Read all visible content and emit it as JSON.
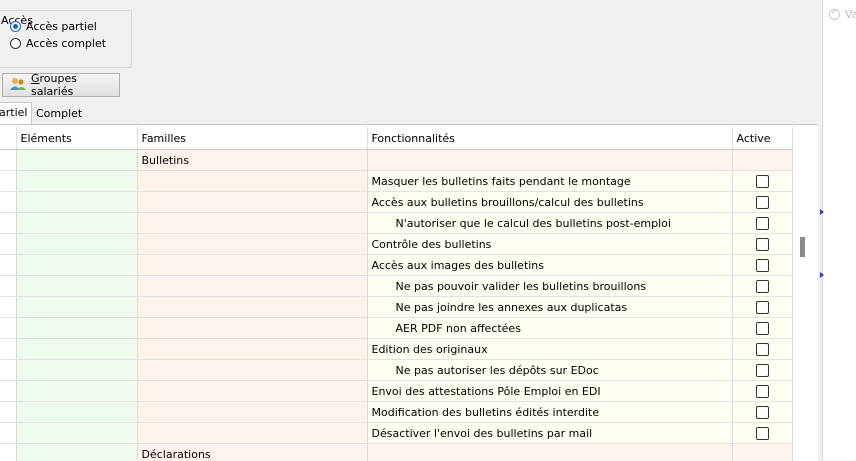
{
  "acces": {
    "legend": "Accès",
    "options": [
      {
        "label": "Accès partiel",
        "selected": true
      },
      {
        "label": "Accès complet",
        "selected": false
      }
    ]
  },
  "groupes_button": {
    "label_underlined": "G",
    "label_rest": "roupes salariés",
    "icon": "group-users-icon"
  },
  "tabs": [
    {
      "label": "artiel",
      "active": true
    },
    {
      "label": "Complet",
      "active": false
    }
  ],
  "grid": {
    "columns": [
      "",
      "Eléments",
      "Familles",
      "Fonctionnalités",
      "Active"
    ],
    "rows": [
      {
        "famille": "Bulletins",
        "fonction": "",
        "indent": false,
        "checkbox": false
      },
      {
        "famille": "",
        "fonction": "Masquer les bulletins faits pendant le montage",
        "indent": false,
        "checkbox": true
      },
      {
        "famille": "",
        "fonction": "Accès aux bulletins brouillons/calcul des bulletins",
        "indent": false,
        "checkbox": true
      },
      {
        "famille": "",
        "fonction": "N'autoriser que le calcul des bulletins post-emploi",
        "indent": true,
        "checkbox": true
      },
      {
        "famille": "",
        "fonction": "Contrôle des bulletins",
        "indent": false,
        "checkbox": true
      },
      {
        "famille": "",
        "fonction": "Accès aux images des bulletins",
        "indent": false,
        "checkbox": true
      },
      {
        "famille": "",
        "fonction": "Ne pas pouvoir valider les bulletins brouillons",
        "indent": true,
        "checkbox": true
      },
      {
        "famille": "",
        "fonction": "Ne pas joindre les annexes aux duplicatas",
        "indent": true,
        "checkbox": true
      },
      {
        "famille": "",
        "fonction": "AER PDF non affectées",
        "indent": true,
        "checkbox": true
      },
      {
        "famille": "",
        "fonction": "Edition des originaux",
        "indent": false,
        "checkbox": true
      },
      {
        "famille": "",
        "fonction": "Ne pas autoriser les dépôts sur EDoc",
        "indent": true,
        "checkbox": true
      },
      {
        "famille": "",
        "fonction": "Envoi des attestations Pôle Emploi en EDI",
        "indent": false,
        "checkbox": true
      },
      {
        "famille": "",
        "fonction": "Modification des bulletins édités interdite",
        "indent": false,
        "checkbox": true
      },
      {
        "famille": "",
        "fonction": "Désactiver l'envoi des bulletins par mail",
        "indent": false,
        "checkbox": true
      },
      {
        "famille": "Déclarations",
        "fonction": "",
        "indent": false,
        "checkbox": false
      }
    ]
  },
  "right_panel": {
    "text": "Va"
  }
}
